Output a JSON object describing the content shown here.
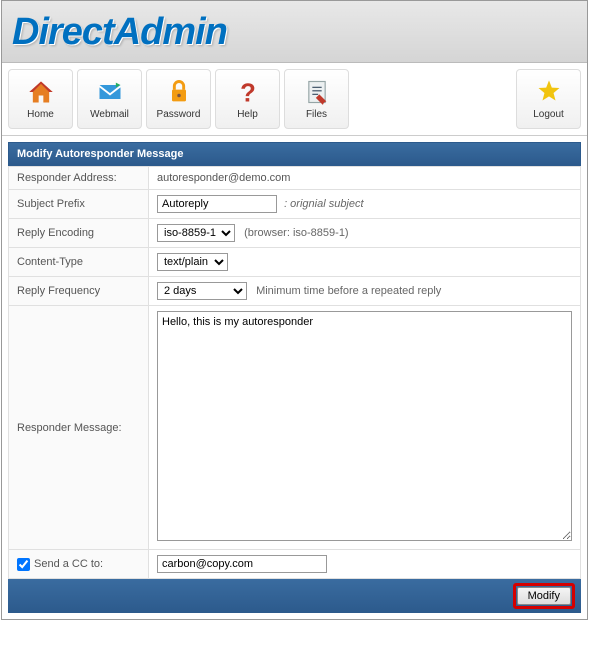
{
  "logo_text": "DirectAdmin",
  "toolbar": {
    "home": "Home",
    "webmail": "Webmail",
    "password": "Password",
    "help": "Help",
    "files": "Files",
    "logout": "Logout"
  },
  "panel": {
    "title": "Modify Autoresponder Message"
  },
  "form": {
    "responder_address_label": "Responder Address:",
    "responder_address_value": "autoresponder@demo.com",
    "subject_prefix_label": "Subject Prefix",
    "subject_prefix_value": "Autoreply",
    "subject_prefix_suffix": ": orignial subject",
    "reply_encoding_label": "Reply Encoding",
    "reply_encoding_value": "iso-8859-1",
    "reply_encoding_hint": "(browser: iso-8859-1)",
    "content_type_label": "Content-Type",
    "content_type_value": "text/plain",
    "reply_frequency_label": "Reply Frequency",
    "reply_frequency_value": "2 days",
    "reply_frequency_hint": "Minimum time before a repeated reply",
    "responder_message_label": "Responder Message:",
    "responder_message_value": "Hello, this is my autoresponder",
    "send_cc_label": "Send a CC to:",
    "send_cc_checked": true,
    "send_cc_value": "carbon@copy.com"
  },
  "modify_button_label": "Modify"
}
